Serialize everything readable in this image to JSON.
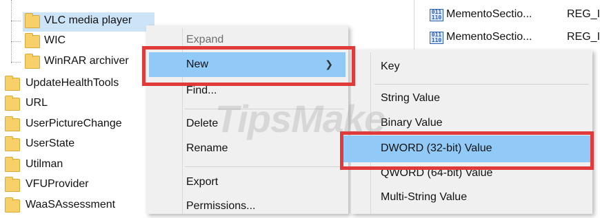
{
  "tree": {
    "items": [
      {
        "label": "VLC media player"
      },
      {
        "label": "WIC"
      },
      {
        "label": "WinRAR archiver"
      },
      {
        "label": "UpdateHealthTools"
      },
      {
        "label": "URL"
      },
      {
        "label": "UserPictureChange"
      },
      {
        "label": "UserState"
      },
      {
        "label": "Utilman"
      },
      {
        "label": "VFUProvider"
      },
      {
        "label": "WaaSAssessment"
      }
    ]
  },
  "context_menu": {
    "items": [
      {
        "label": "Expand",
        "disabled": true
      },
      {
        "label": "New",
        "highlighted": true,
        "submenu": true
      },
      {
        "label": "Find..."
      },
      {
        "label": "Delete"
      },
      {
        "label": "Rename"
      },
      {
        "label": "Export"
      },
      {
        "label": "Permissions..."
      }
    ],
    "chevron": "chevron-right-icon"
  },
  "submenu": {
    "items": [
      {
        "label": "Key"
      },
      {
        "label": "String Value"
      },
      {
        "label": "Binary Value"
      },
      {
        "label": "DWORD (32-bit) Value",
        "highlighted": true
      },
      {
        "label": "QWORD (64-bit) Value"
      },
      {
        "label": "Multi-String Value"
      }
    ]
  },
  "values_pane": {
    "rows": [
      {
        "name": "MementoSectio...",
        "type": "REG_I"
      },
      {
        "name": "MementoSectio...",
        "type": "REG_I"
      }
    ],
    "icon": "binary-value-icon"
  },
  "watermark": "TipsMake",
  "colors": {
    "highlight": "#91c9f7",
    "annotation_red": "#e03a3a",
    "menu_bg": "#f0f0f0",
    "folder": "#f7d06a"
  }
}
